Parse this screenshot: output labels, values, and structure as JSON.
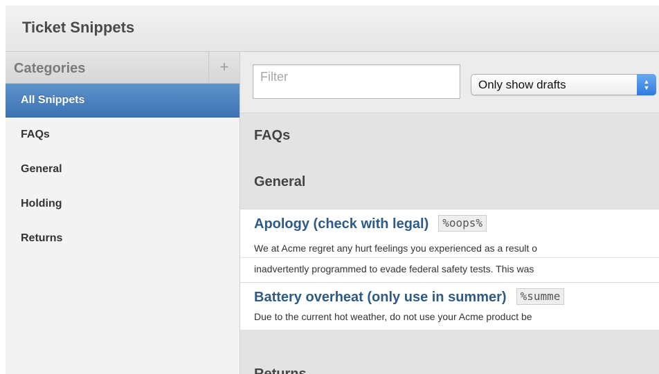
{
  "window": {
    "title": "Ticket Snippets"
  },
  "sidebar": {
    "header_label": "Categories",
    "add_label": "+",
    "items": [
      {
        "label": "All Snippets",
        "selected": true
      },
      {
        "label": "FAQs"
      },
      {
        "label": "General"
      },
      {
        "label": "Holding"
      },
      {
        "label": "Returns"
      }
    ]
  },
  "toolbar": {
    "filter": {
      "placeholder": "Filter",
      "value": ""
    },
    "select": {
      "value": "Only show drafts",
      "arrow_icon": "up-down-arrows-icon"
    }
  },
  "sections": [
    {
      "title": "FAQs"
    },
    {
      "title": "General"
    },
    {
      "title": "Returns"
    }
  ],
  "snippets": [
    {
      "title": "Apology (check with legal)",
      "tag": "%oops%",
      "body_line1": "We at Acme regret any hurt feelings you experienced as a result o",
      "body_line2": "inadvertently programmed to evade federal safety tests. This was"
    },
    {
      "title": "Battery overheat (only use in summer)",
      "tag": "%summe",
      "body_line1": "Due to the current hot weather, do not use your Acme product be"
    }
  ],
  "colors": {
    "selection": "#4a80bf",
    "snippet_title": "#2e5a86",
    "select_arrow": "#3b86e8"
  }
}
